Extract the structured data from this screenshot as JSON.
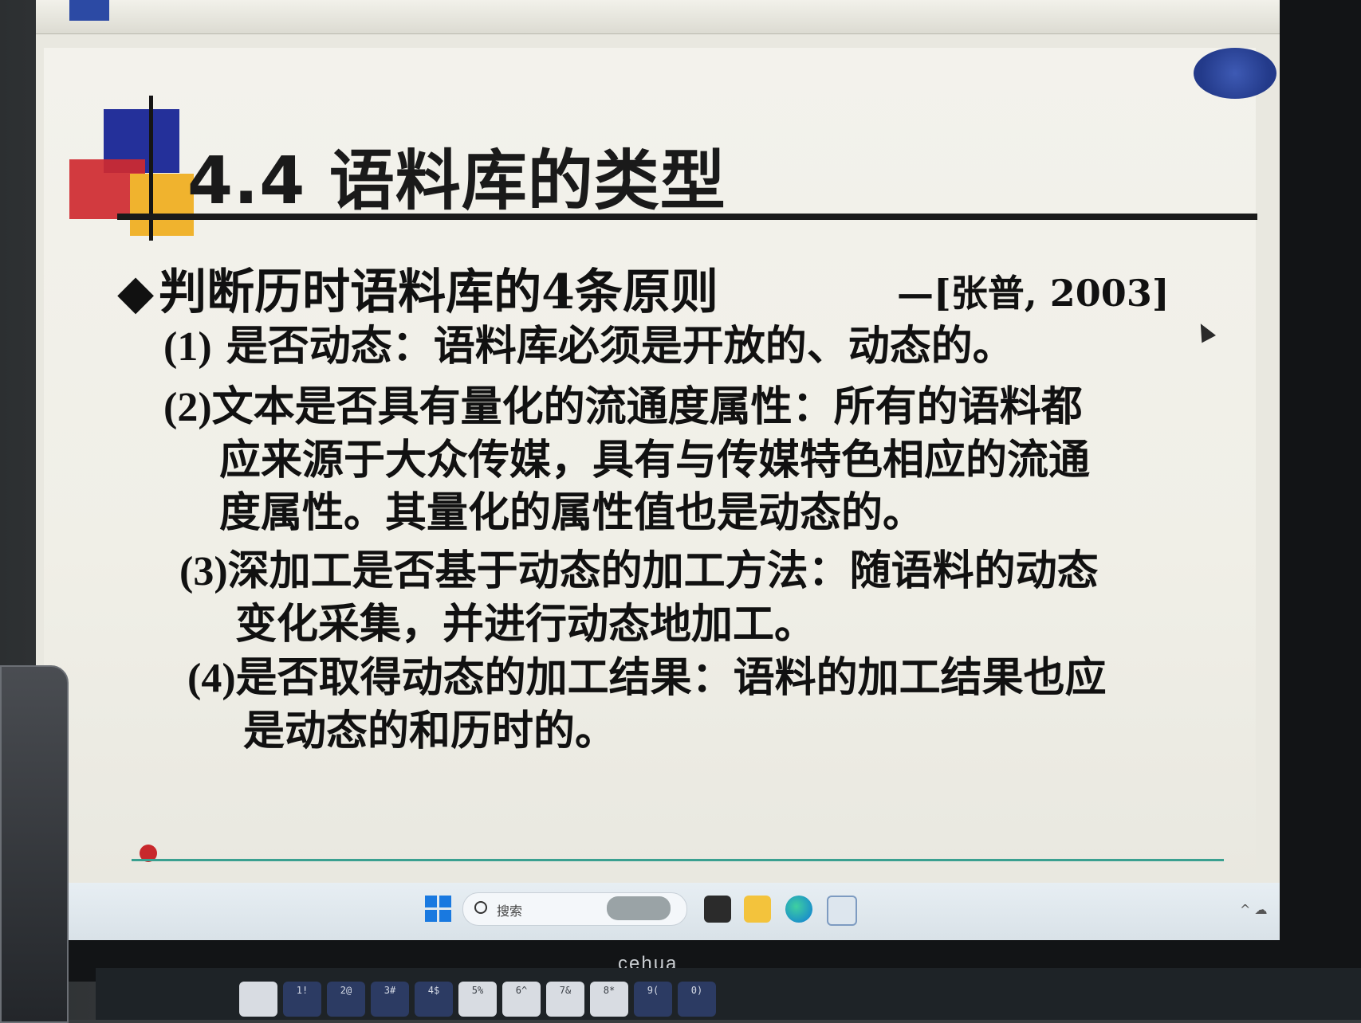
{
  "slide": {
    "title": "4.4 语料库的类型",
    "bullet": "◆",
    "principles_heading": "判断历时语料库的4条原则",
    "citation": "—[张普, 2003]",
    "items": [
      {
        "number": "(1)",
        "lines": [
          "是否动态：语料库必须是开放的、动态的。"
        ]
      },
      {
        "number": "(2)",
        "lines": [
          "文本是否具有量化的流通度属性：所有的语料都",
          "应来源于大众传媒，具有与传媒特色相应的流通",
          "度属性。其量化的属性值也是动态的。"
        ]
      },
      {
        "number": "(3)",
        "lines": [
          "深加工是否基于动态的加工方法：随语料的动态",
          "变化采集，并进行动态地加工。"
        ]
      },
      {
        "number": "(4)",
        "lines": [
          "是否取得动态的加工结果：语料的加工结果也应",
          "是动态的和历时的。"
        ]
      }
    ],
    "colors": {
      "deco_blue": "#24309a",
      "deco_red": "#cf2a30",
      "deco_yellow": "#f0b32e",
      "footer_rule": "#3aa090",
      "footer_text": "#2a3a8a"
    }
  },
  "taskbar": {
    "search_placeholder": "搜索",
    "apps": [
      "start-icon",
      "search-icon",
      "task-view-icon",
      "file-explorer-icon",
      "edge-icon",
      "app-icon"
    ]
  },
  "monitor": {
    "brand": "cehua"
  },
  "keyboard": {
    "keys": [
      "1!",
      "2@",
      "3#",
      "4$",
      "5%",
      "6^",
      "7&",
      "8*",
      "9(",
      "0)"
    ]
  }
}
